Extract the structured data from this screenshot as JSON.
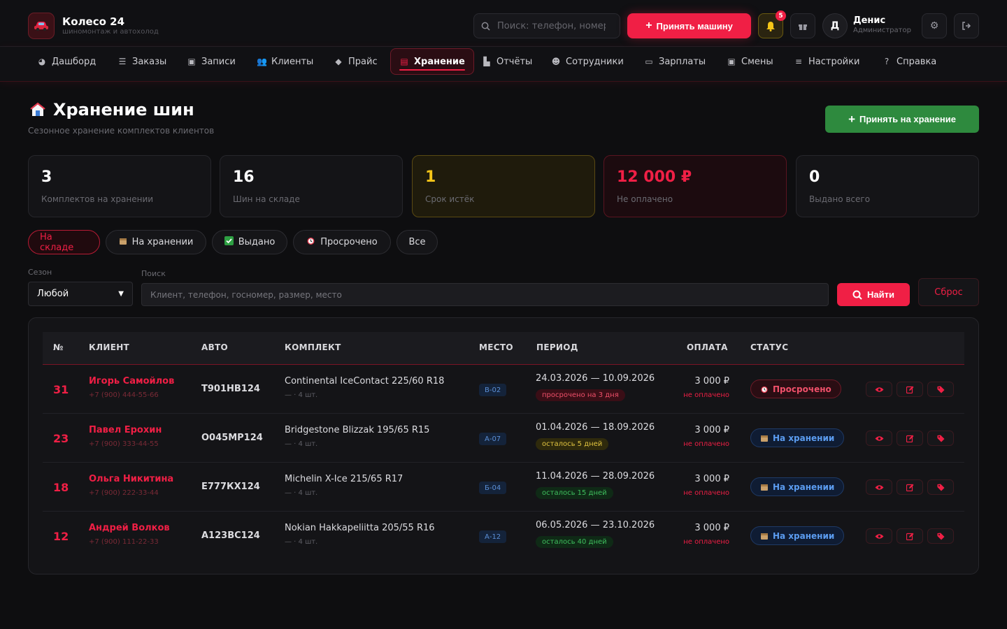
{
  "header": {
    "brand_name": "Колесо 24",
    "brand_sub": "шиномонтаж и автохолод",
    "search_placeholder": "Поиск: телефон, номер",
    "accept_car_label": "Принять машину",
    "notif_count": "5",
    "user_initial": "Д",
    "user_name": "Денис",
    "user_role": "Администратор"
  },
  "nav": {
    "items": [
      {
        "label": "Дашборд",
        "icon": "dashboard-icon"
      },
      {
        "label": "Заказы",
        "icon": "list-icon"
      },
      {
        "label": "Записи",
        "icon": "calendar-icon"
      },
      {
        "label": "Клиенты",
        "icon": "users-icon"
      },
      {
        "label": "Прайс",
        "icon": "tag-icon"
      },
      {
        "label": "Хранение",
        "icon": "warehouse-icon"
      },
      {
        "label": "Отчёты",
        "icon": "chart-icon"
      },
      {
        "label": "Сотрудники",
        "icon": "staff-icon"
      },
      {
        "label": "Зарплаты",
        "icon": "money-icon"
      },
      {
        "label": "Смены",
        "icon": "shift-icon"
      },
      {
        "label": "Настройки",
        "icon": "sliders-icon"
      },
      {
        "label": "Справка",
        "icon": "help-icon"
      }
    ],
    "active": "Хранение"
  },
  "page": {
    "title": "Хранение шин",
    "subtitle": "Сезонное хранение комплектов клиентов",
    "add_button": "Принять на хранение"
  },
  "stats": [
    {
      "value": "3",
      "label": "Комплектов на хранении"
    },
    {
      "value": "16",
      "label": "Шин на складе"
    },
    {
      "value": "1",
      "label": "Срок истёк"
    },
    {
      "value": "12 000 ₽",
      "label": "Не оплачено"
    },
    {
      "value": "0",
      "label": "Выдано всего"
    }
  ],
  "filters": {
    "chips": [
      {
        "label": "На складе",
        "icon": ""
      },
      {
        "label": "На хранении",
        "icon": "box-icon"
      },
      {
        "label": "Выдано",
        "icon": "check-icon"
      },
      {
        "label": "Просрочено",
        "icon": "alarm-icon"
      },
      {
        "label": "Все",
        "icon": ""
      }
    ],
    "active": "На складе",
    "season_label": "Сезон",
    "season_value": "Любой",
    "search_label": "Поиск",
    "search_placeholder": "Клиент, телефон, госномер, размер, место",
    "find_label": "Найти",
    "reset_label": "Сброс"
  },
  "table": {
    "columns": [
      "№",
      "КЛИЕНТ",
      "АВТО",
      "КОМПЛЕКТ",
      "МЕСТО",
      "ПЕРИОД",
      "ОПЛАТА",
      "СТАТУС"
    ],
    "rows": [
      {
        "num": "31",
        "client": "Игорь Самойлов",
        "phone": "+7 (900) 444-55-66",
        "plate": "Т901НВ124",
        "kit": "Continental IceContact 225/60 R18",
        "kit_sub": "— · 4 шт.",
        "place": "В-02",
        "period": "24.03.2026 — 10.09.2026",
        "period_tag": "просрочено на 3 дня",
        "tag_color": "red",
        "pay": "3 000 ₽",
        "pay_sub": "не оплачено",
        "status": "Просрочено",
        "status_type": "over"
      },
      {
        "num": "23",
        "client": "Павел Ерохин",
        "phone": "+7 (900) 333-44-55",
        "plate": "О045МР124",
        "kit": "Bridgestone Blizzak 195/65 R15",
        "kit_sub": "— · 4 шт.",
        "place": "А-07",
        "period": "01.04.2026 — 18.09.2026",
        "period_tag": "осталось 5 дней",
        "tag_color": "yellow",
        "pay": "3 000 ₽",
        "pay_sub": "не оплачено",
        "status": "На хранении",
        "status_type": "store"
      },
      {
        "num": "18",
        "client": "Ольга Никитина",
        "phone": "+7 (900) 222-33-44",
        "plate": "Е777КХ124",
        "kit": "Michelin X-Ice 215/65 R17",
        "kit_sub": "— · 4 шт.",
        "place": "Б-04",
        "period": "11.04.2026 — 28.09.2026",
        "period_tag": "осталось 15 дней",
        "tag_color": "green",
        "pay": "3 000 ₽",
        "pay_sub": "не оплачено",
        "status": "На хранении",
        "status_type": "store"
      },
      {
        "num": "12",
        "client": "Андрей Волков",
        "phone": "+7 (900) 111-22-33",
        "plate": "А123ВС124",
        "kit": "Nokian Hakkapeliitta 205/55 R16",
        "kit_sub": "— · 4 шт.",
        "place": "А-12",
        "period": "06.05.2026 — 23.10.2026",
        "period_tag": "осталось 40 дней",
        "tag_color": "green",
        "pay": "3 000 ₽",
        "pay_sub": "не оплачено",
        "status": "На хранении",
        "status_type": "store"
      }
    ]
  },
  "colors": {
    "accent": "#f01f45",
    "success": "#2e8a3e",
    "warning": "#f5c518",
    "info": "#5b9cf0"
  }
}
